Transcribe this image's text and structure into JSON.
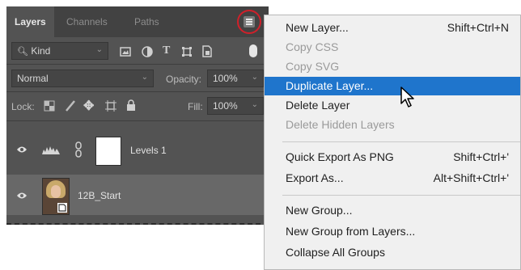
{
  "panel": {
    "tabs": [
      "Layers",
      "Channels",
      "Paths"
    ],
    "filter_kind": "Kind",
    "blend_mode": "Normal",
    "opacity_label": "Opacity:",
    "opacity_value": "100%",
    "lock_label": "Lock:",
    "fill_label": "Fill:",
    "fill_value": "100%",
    "layers": [
      {
        "name": "Levels 1"
      },
      {
        "name": "12B_Start"
      }
    ],
    "icons": {
      "search": "search-icon",
      "menu": "panel-menu-icon",
      "visibility": "eye-icon"
    }
  },
  "menu": {
    "items": [
      {
        "label": "New Layer...",
        "shortcut": "Shift+Ctrl+N"
      },
      {
        "label": "Copy CSS",
        "shortcut": ""
      },
      {
        "label": "Copy SVG",
        "shortcut": ""
      },
      {
        "label": "Duplicate Layer...",
        "shortcut": ""
      },
      {
        "label": "Delete Layer",
        "shortcut": ""
      },
      {
        "label": "Delete Hidden Layers",
        "shortcut": ""
      },
      {
        "label": "Quick Export As PNG",
        "shortcut": "Shift+Ctrl+'"
      },
      {
        "label": "Export As...",
        "shortcut": "Alt+Shift+Ctrl+'"
      },
      {
        "label": "New Group...",
        "shortcut": ""
      },
      {
        "label": "New Group from Layers...",
        "shortcut": ""
      },
      {
        "label": "Collapse All Groups",
        "shortcut": ""
      }
    ]
  },
  "colors": {
    "highlight": "#1f75cc",
    "annotation_ring": "#d0202a",
    "panel_bg": "#535353"
  }
}
